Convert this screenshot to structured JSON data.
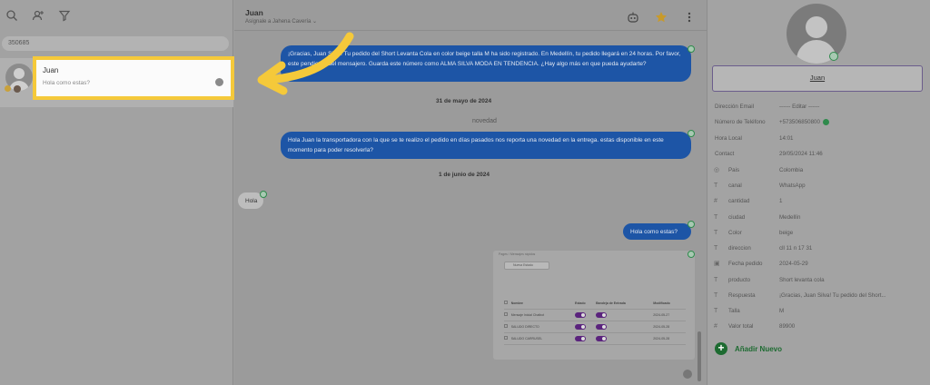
{
  "left_panel": {
    "search_value": "350685",
    "contact": {
      "name": "Juan",
      "preview": "Hola como estas?"
    }
  },
  "header": {
    "contact_name": "Juan",
    "assign_label": "Asígnale a Jahena Cavería"
  },
  "messages": {
    "out1": "¡Gracias, Juan Silva! Tu pedido del Short Levanta Cola en color beige talla M ha sido registrado. En Medellín, tu pedido llegará en 24 horas. Por favor, este pendiente del mensajero. Guarda este número como ALMA SILVA MODA EN TENDENCIA. ¿Hay algo más en que pueda ayudarte?",
    "date1": "31 de mayo de 2024",
    "note": "novedad",
    "out2": "Hola Juan la transportadora con la que se te realizo el pedido en días pasados nos reporta una novedad en la entrega. estas disponible en este momento para poder resolverla?",
    "date2": "1 de junio de 2024",
    "in1": "Hola",
    "out3": "Hola como estas?"
  },
  "screenshot_card": {
    "top": "Pages / Mensajes rápidos",
    "search": "Nueva Estado",
    "headers": [
      "Nombre",
      "Estado",
      "Bandeja de Entrada",
      "Modificado"
    ],
    "rows": [
      [
        "Mensaje Inicial Chatbot",
        "2024-05-27"
      ],
      [
        "SALUDO DIRECTO",
        "2024-05-28"
      ],
      [
        "SALUDO CARRUSEL",
        "2024-05-28"
      ]
    ]
  },
  "right_panel": {
    "name": "Juan",
    "fields": [
      {
        "key": "Dirección Email",
        "value": "------ Editar ------"
      },
      {
        "key": "Número de Teléfono",
        "value": "+573506850800"
      },
      {
        "key": "Hora Local",
        "value": "14:01"
      },
      {
        "key": "Contact",
        "value": "29/05/2024 11:46"
      }
    ],
    "custom_fields": [
      {
        "key": "Pais",
        "value": "Colombia",
        "icon": "globe-icon"
      },
      {
        "key": "canal",
        "value": "WhatsApp",
        "icon": "text-icon"
      },
      {
        "key": "cantidad",
        "value": "1",
        "icon": "hash-icon"
      },
      {
        "key": "ciudad",
        "value": "Medellín",
        "icon": "text-icon"
      },
      {
        "key": "Color",
        "value": "beige",
        "icon": "text-icon"
      },
      {
        "key": "direccion",
        "value": "cll 11 n 17 31",
        "icon": "text-icon"
      },
      {
        "key": "Fecha pedido",
        "value": "2024-05-29",
        "icon": "calendar-icon"
      },
      {
        "key": "producto",
        "value": "Short levanta cola",
        "icon": "text-icon"
      },
      {
        "key": "Respuesta",
        "value": "¡Gracias, Juan Silva! Tu pedido del Short...",
        "icon": "text-icon"
      },
      {
        "key": "Talla",
        "value": "M",
        "icon": "text-icon"
      },
      {
        "key": "Valor total",
        "value": "89900",
        "icon": "hash-icon"
      }
    ],
    "add_label": "Añadir Nuevo"
  },
  "colors": {
    "highlight": "#f5c93a",
    "outgoing_bubble": "#1d55a6",
    "add_green": "#1d6b31"
  }
}
